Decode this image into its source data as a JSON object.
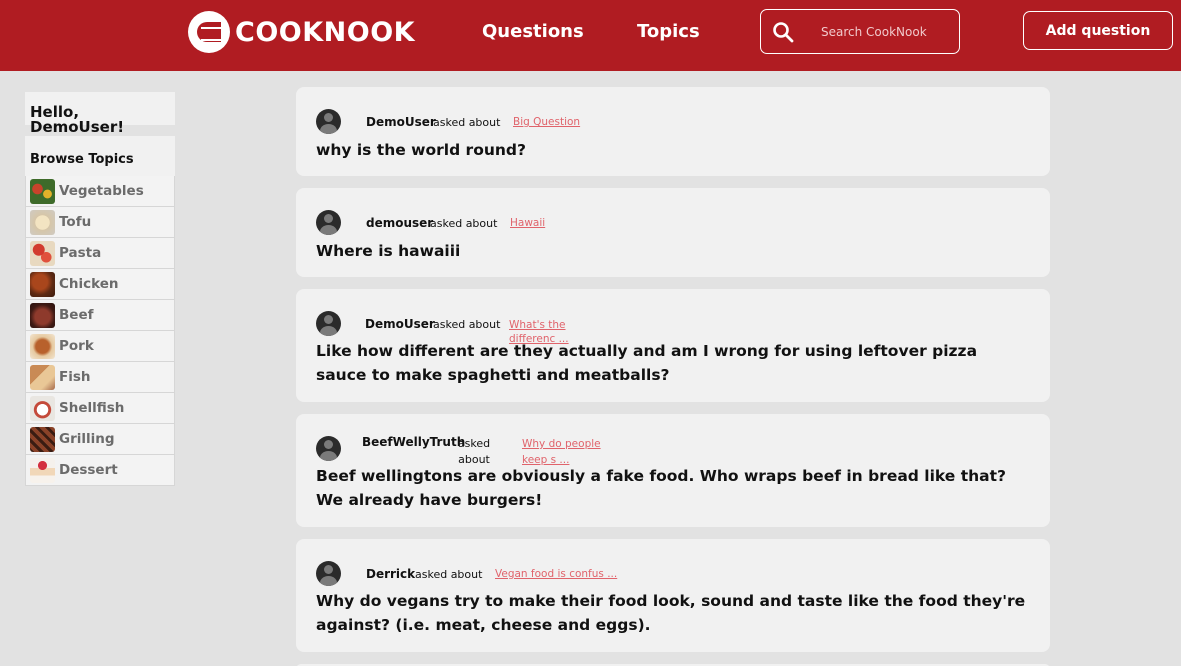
{
  "header": {
    "logo_text": "COOKNOOK",
    "nav": [
      "Questions",
      "Topics"
    ],
    "search_placeholder": "Search CookNook",
    "add_question_label": "Add question",
    "brand_color": "#b01c22"
  },
  "sidebar": {
    "greeting": "Hello, DemoUser!",
    "browse_title": "Browse Topics",
    "topics": [
      {
        "label": "Vegetables",
        "icon": "vegetables-thumbnail"
      },
      {
        "label": "Tofu",
        "icon": "tofu-thumbnail"
      },
      {
        "label": "Pasta",
        "icon": "pasta-thumbnail"
      },
      {
        "label": "Chicken",
        "icon": "chicken-thumbnail"
      },
      {
        "label": "Beef",
        "icon": "beef-thumbnail"
      },
      {
        "label": "Pork",
        "icon": "pork-thumbnail"
      },
      {
        "label": "Fish",
        "icon": "fish-thumbnail"
      },
      {
        "label": "Shellfish",
        "icon": "shellfish-thumbnail"
      },
      {
        "label": "Grilling",
        "icon": "grilling-thumbnail"
      },
      {
        "label": "Dessert",
        "icon": "dessert-thumbnail"
      }
    ]
  },
  "feed": {
    "asked_text": "asked about",
    "questions": [
      {
        "user": "DemoUser",
        "topic": "Big Question",
        "question": "why is the world round?"
      },
      {
        "user": "demouser",
        "topic": "Hawaii",
        "question": "Where is hawaiii"
      },
      {
        "user": "DemoUser",
        "topic": "What's the differenc ...",
        "question": "Like how different are they actually and am I wrong for using leftover pizza sauce to make spaghetti and meatballs?"
      },
      {
        "user": "BeefWellyTruth",
        "topic": "Why do people keep s ...",
        "question": "Beef wellingtons are obviously a fake food. Who wraps beef in bread like that? We already have burgers!"
      },
      {
        "user": "Derrick",
        "topic": "Vegan food is confus ...",
        "question": "Why do vegans try to make their food look, sound and taste like the food they're against? (i.e. meat, cheese and eggs)."
      }
    ]
  }
}
